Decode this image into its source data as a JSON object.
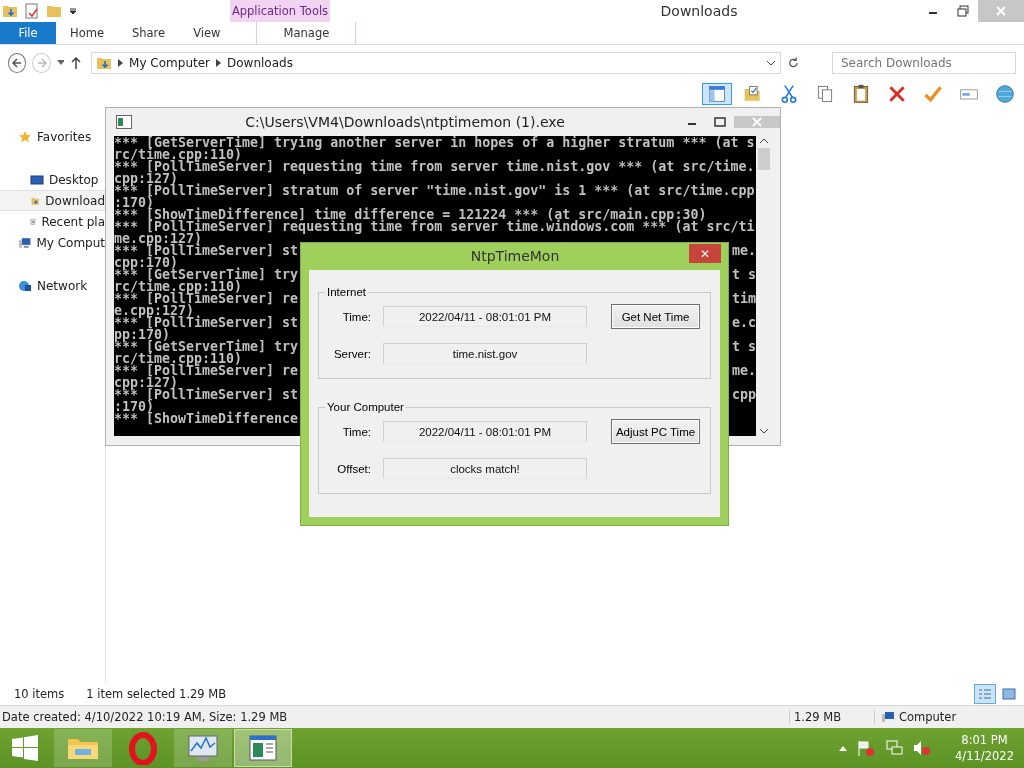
{
  "explorer": {
    "title": "Downloads",
    "contextual_group": "Application Tools",
    "ribbon_tabs": [
      {
        "label": "File",
        "kind": "file"
      },
      {
        "label": "Home",
        "kind": "tab"
      },
      {
        "label": "Share",
        "kind": "tab"
      },
      {
        "label": "View",
        "kind": "tab"
      },
      {
        "label": "Manage",
        "kind": "contextual"
      }
    ],
    "address": [
      "My Computer",
      "Downloads"
    ],
    "search": {
      "placeholder": "Search Downloads"
    },
    "toolbar": [
      {
        "kind": "layout",
        "selected": true
      },
      {
        "kind": "folder",
        "selected": false
      },
      {
        "kind": "cut",
        "selected": false
      },
      {
        "kind": "copy",
        "selected": false
      },
      {
        "kind": "paste",
        "selected": false
      },
      {
        "kind": "delete",
        "selected": false
      },
      {
        "kind": "check",
        "selected": false
      },
      {
        "kind": "rename",
        "selected": false
      },
      {
        "kind": "globe",
        "selected": false
      }
    ],
    "nav": [
      {
        "label": "Favorites",
        "kind": "star",
        "selected": false,
        "children": [
          {
            "label": "Desktop",
            "kind": "desktop",
            "selected": false
          },
          {
            "label": "Download",
            "kind": "downloads",
            "selected": true
          },
          {
            "label": "Recent pla",
            "kind": "recent",
            "selected": false
          }
        ]
      },
      {
        "label": "My Comput",
        "kind": "computer",
        "selected": false
      },
      {
        "label": "Network",
        "kind": "network",
        "selected": false
      }
    ],
    "status": {
      "items": "10 items",
      "selection": "1 item selected  1.29 MB"
    },
    "view_buttons": [
      {
        "kind": "details",
        "selected": true
      },
      {
        "kind": "large",
        "selected": false
      }
    ],
    "details": {
      "info": "Date created: 4/10/2022 10:19 AM, Size: 1.29 MB",
      "size": "1.29 MB",
      "location": "Computer"
    }
  },
  "console": {
    "title": "C:\\Users\\VM4\\Downloads\\ntptimemon (1).exe",
    "lines": [
      {
        "left": "*** [GetServerTime] trying another server in hopes of a higher stratum *** (at s"
      },
      {
        "left": "rc/time.cpp:110)"
      },
      {
        "left": "*** [PollTimeServer] requesting time from server time.nist.gov *** (at src/time."
      },
      {
        "left": "cpp:127)"
      },
      {
        "left": "*** [PollTimeServer] stratum of server \"time.nist.gov\" is 1 *** (at src/time.cpp"
      },
      {
        "left": ":170)"
      },
      {
        "left": "*** [ShowTimeDifference] time difference = 121224 *** (at src/main.cpp:30)"
      },
      {
        "left": "*** [PollTimeServer] requesting time from server time.windows.com *** (at src/ti"
      },
      {
        "left": "me.cpp:127)"
      },
      {
        "left": "*** [PollTimeServer] st",
        "right": "me."
      },
      {
        "left": "cpp:170)"
      },
      {
        "left": "*** [GetServerTime] try",
        "right": "t s"
      },
      {
        "left": "rc/time.cpp:110)"
      },
      {
        "left": "*** [PollTimeServer] re",
        "right": "tim"
      },
      {
        "left": "e.cpp:127)"
      },
      {
        "left": "*** [PollTimeServer] st",
        "right": "e.c"
      },
      {
        "left": "pp:170)"
      },
      {
        "left": "*** [GetServerTime] try",
        "right": "t s"
      },
      {
        "left": "rc/time.cpp:110)"
      },
      {
        "left": "*** [PollTimeServer] re",
        "right": "me."
      },
      {
        "left": "cpp:127)"
      },
      {
        "left": "*** [PollTimeServer] st",
        "right": "cpp"
      },
      {
        "left": ":170)"
      },
      {
        "left": "*** [ShowTimeDifference"
      }
    ]
  },
  "dialog": {
    "title": "NtpTimeMon",
    "close": "✕",
    "groups": [
      {
        "legend": "Internet",
        "rows": [
          {
            "label": "Time:",
            "value": "2022/04/11 - 08:01:01 PM",
            "button": "Get Net Time"
          },
          {
            "label": "Server:",
            "value": "time.nist.gov"
          }
        ]
      },
      {
        "legend": "Your Computer",
        "rows": [
          {
            "label": "Time:",
            "value": "2022/04/11 - 08:01:01 PM",
            "button": "Adjust PC Time"
          },
          {
            "label": "Offset:",
            "value": "clocks match!"
          }
        ]
      }
    ]
  },
  "taskbar": {
    "apps": [
      {
        "kind": "explorer",
        "selected": false
      },
      {
        "kind": "browser",
        "selected": false
      },
      {
        "kind": "monitor",
        "selected": false
      },
      {
        "kind": "console",
        "selected": true
      }
    ],
    "time": "8:01 PM",
    "date": "4/11/2022"
  }
}
